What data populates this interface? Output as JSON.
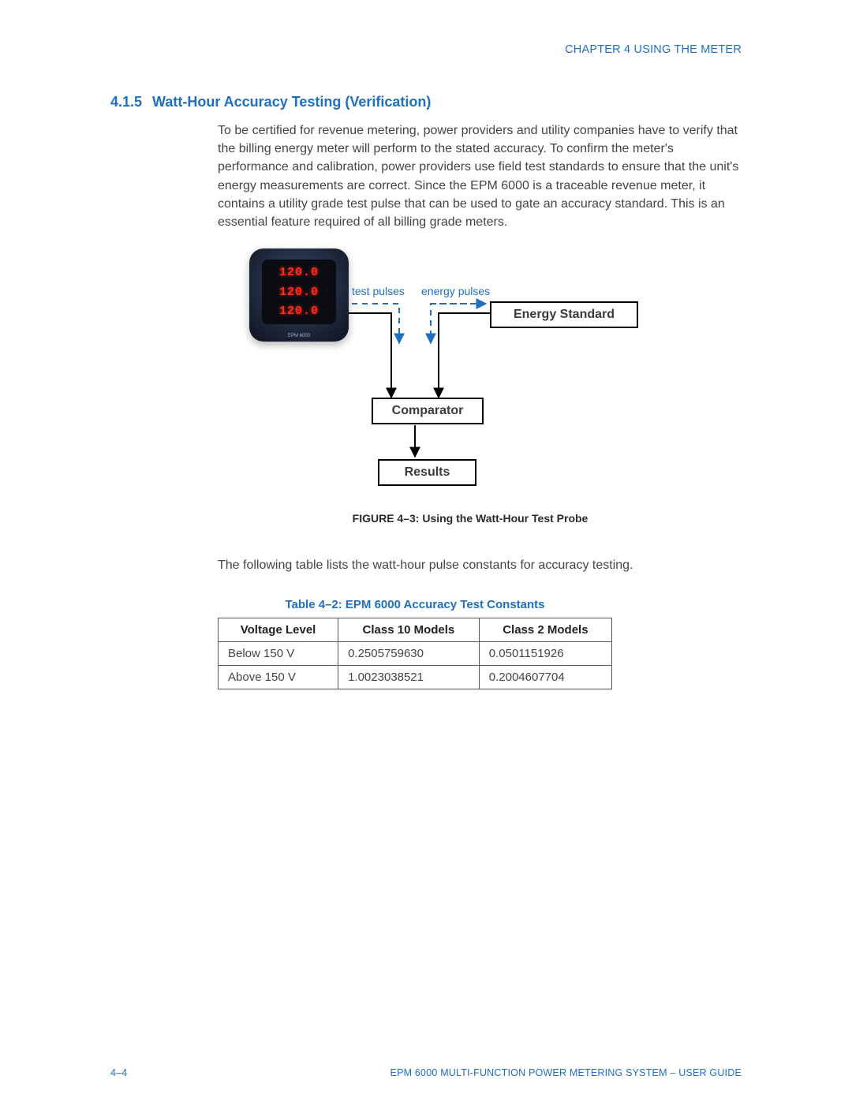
{
  "header": {
    "chapter": "CHAPTER 4  USING THE METER"
  },
  "section": {
    "number": "4.1.5",
    "title": "Watt-Hour Accuracy Testing (Verification)",
    "para1": "To be certified for revenue metering, power providers and utility companies have to verify that the billing energy meter will perform to the stated accuracy. To confirm the meter's performance and calibration, power providers use field test standards to ensure that the unit's energy measurements are correct. Since the EPM 6000 is a traceable revenue meter, it contains a utility grade test pulse that can be used to gate an accuracy standard. This is an essential feature required of all billing grade meters.",
    "para2": "The following table lists the watt-hour pulse constants for accuracy testing."
  },
  "figure": {
    "caption": "FIGURE 4–3: Using the Watt-Hour Test Probe",
    "labels": {
      "test_pulses": "test pulses",
      "energy_pulses": "energy pulses",
      "energy_standard": "Energy Standard",
      "comparator": "Comparator",
      "results": "Results"
    },
    "meter_readouts": [
      "120.0",
      "120.0",
      "120.0"
    ]
  },
  "table": {
    "title": "Table 4–2: EPM 6000 Accuracy Test Constants",
    "headers": [
      "Voltage Level",
      "Class 10 Models",
      "Class 2 Models"
    ],
    "rows": [
      [
        "Below 150 V",
        "0.2505759630",
        "0.0501151926"
      ],
      [
        "Above 150 V",
        "1.0023038521",
        "0.2004607704"
      ]
    ]
  },
  "footer": {
    "page_no": "4–4",
    "doc_title": "EPM 6000 MULTI-FUNCTION POWER METERING SYSTEM – USER GUIDE"
  }
}
